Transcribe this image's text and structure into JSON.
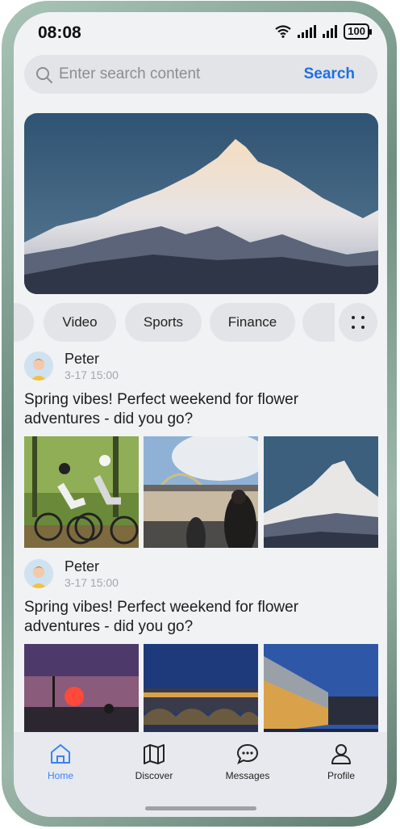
{
  "status": {
    "time": "08:08",
    "battery": "100"
  },
  "search": {
    "placeholder": "Enter search content",
    "button": "Search"
  },
  "categories": [
    "",
    "Video",
    "Sports",
    "Finance",
    ""
  ],
  "posts": [
    {
      "user": "Peter",
      "date": "3-17 15:00",
      "text": "Spring vibes! Perfect weekend for flower adventures - did you go?"
    },
    {
      "user": "Peter",
      "date": "3-17 15:00",
      "text": "Spring vibes! Perfect weekend for flower adventures - did you go?"
    }
  ],
  "tabbar": [
    {
      "label": "Home",
      "icon": "home-icon",
      "active": true
    },
    {
      "label": "Discover",
      "icon": "map-icon",
      "active": false
    },
    {
      "label": "Messages",
      "icon": "chat-bubble-icon",
      "active": false
    },
    {
      "label": "Profile",
      "icon": "person-icon",
      "active": false
    }
  ],
  "colors": {
    "accent": "#1f6fe5",
    "tab_active": "#3b82f6",
    "background": "#f1f2f4"
  }
}
